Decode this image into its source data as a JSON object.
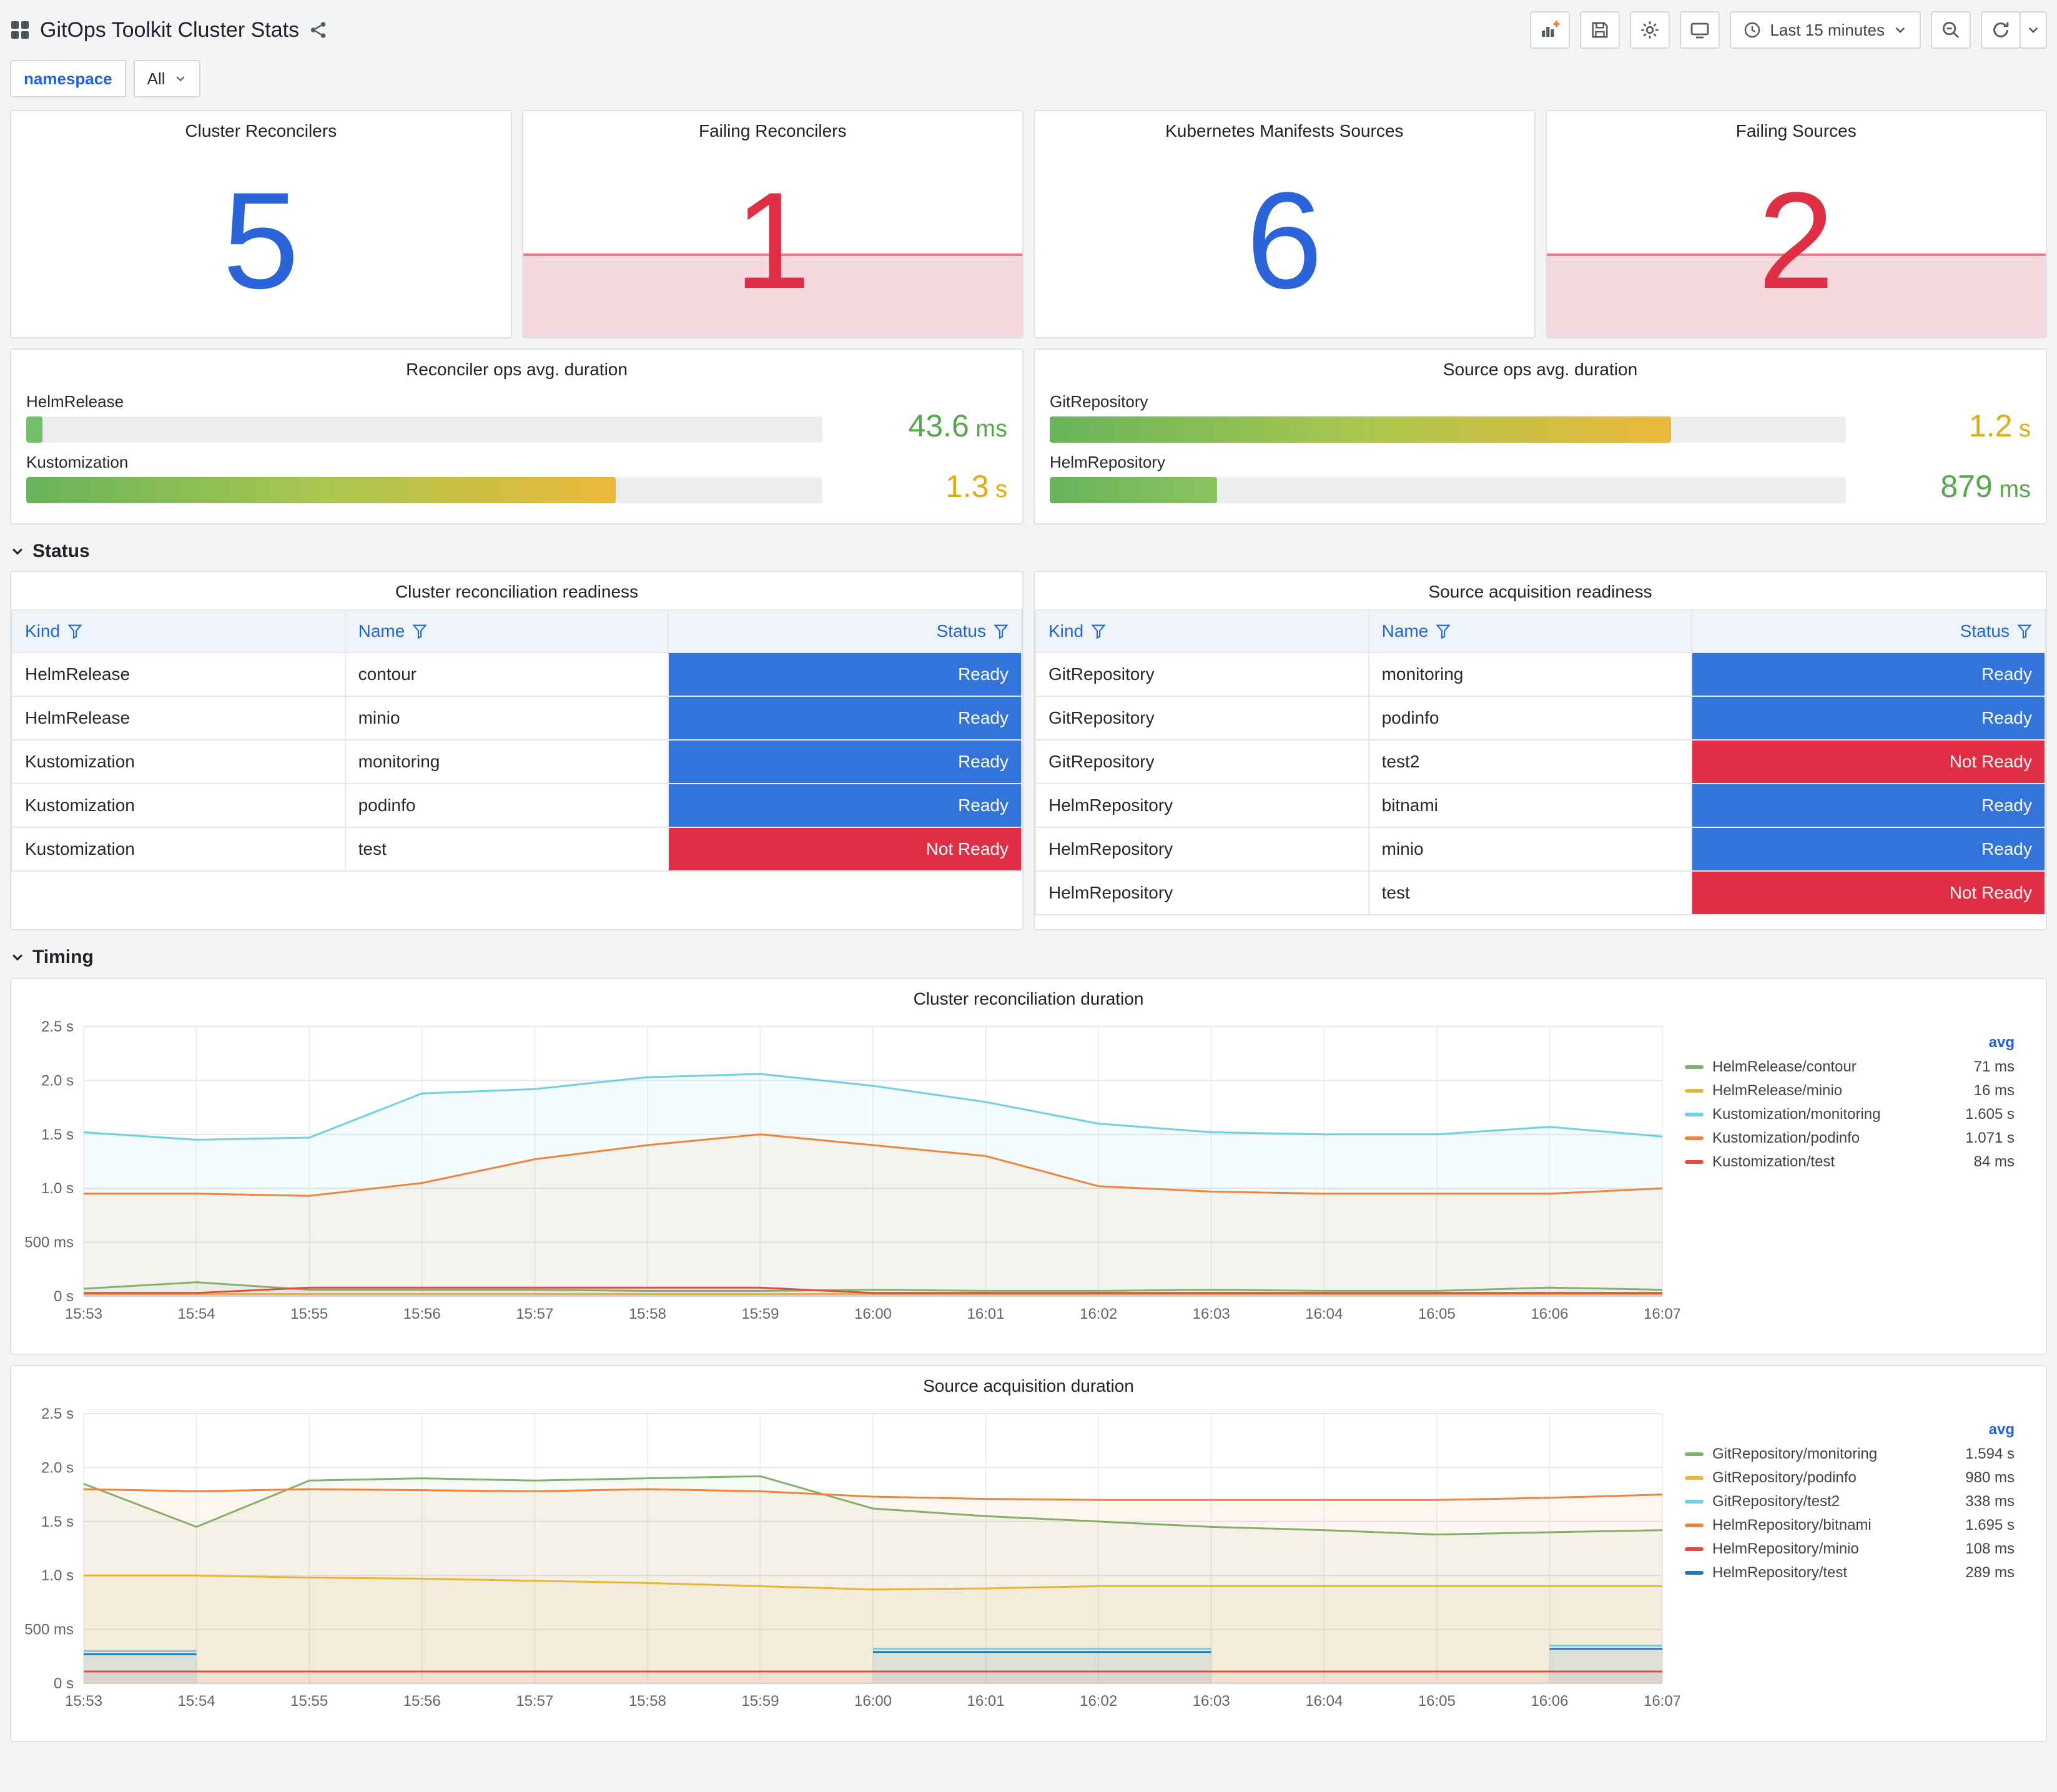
{
  "header": {
    "title": "GitOps Toolkit Cluster Stats"
  },
  "toolbar": {
    "time_range": "Last 15 minutes"
  },
  "variables": {
    "label": "namespace",
    "value": "All"
  },
  "stats": [
    {
      "title": "Cluster Reconcilers",
      "value": "5",
      "color": "#2B63D9",
      "failing": false
    },
    {
      "title": "Failing Reconcilers",
      "value": "1",
      "color": "#DE2F44",
      "failing": true
    },
    {
      "title": "Kubernetes Manifests Sources",
      "value": "6",
      "color": "#2B63D9",
      "failing": false
    },
    {
      "title": "Failing Sources",
      "value": "2",
      "color": "#DE2F44",
      "failing": true
    }
  ],
  "gauges": [
    {
      "title": "Reconciler ops avg. duration",
      "rows": [
        {
          "label": "HelmRelease",
          "pct": 2,
          "gradient": [
            "#73BF69",
            "#73BF69"
          ],
          "value": "43.6",
          "unit": "ms",
          "value_color": "#56A64B"
        },
        {
          "label": "Kustomization",
          "pct": 74,
          "gradient": [
            "#68B35B",
            "#A9C74F",
            "#EAB839"
          ],
          "value": "1.3",
          "unit": "s",
          "value_color": "#DFAB0E"
        }
      ]
    },
    {
      "title": "Source ops avg. duration",
      "rows": [
        {
          "label": "GitRepository",
          "pct": 78,
          "gradient": [
            "#68B35B",
            "#A9C74F",
            "#EAB839"
          ],
          "value": "1.2",
          "unit": "s",
          "value_color": "#DFAB0E"
        },
        {
          "label": "HelmRepository",
          "pct": 21,
          "gradient": [
            "#68B35B",
            "#8CC45F"
          ],
          "value": "879",
          "unit": "ms",
          "value_color": "#56A64B"
        }
      ]
    }
  ],
  "status_section": {
    "label": "Status"
  },
  "timing_section": {
    "label": "Timing"
  },
  "status_colors": {
    "Ready": "#3274D9",
    "Not Ready": "#E02F44"
  },
  "tables": [
    {
      "title": "Cluster reconciliation readiness",
      "columns": [
        "Kind",
        "Name",
        "Status"
      ],
      "rows": [
        [
          "HelmRelease",
          "contour",
          "Ready"
        ],
        [
          "HelmRelease",
          "minio",
          "Ready"
        ],
        [
          "Kustomization",
          "monitoring",
          "Ready"
        ],
        [
          "Kustomization",
          "podinfo",
          "Ready"
        ],
        [
          "Kustomization",
          "test",
          "Not Ready"
        ]
      ]
    },
    {
      "title": "Source acquisition readiness",
      "columns": [
        "Kind",
        "Name",
        "Status"
      ],
      "rows": [
        [
          "GitRepository",
          "monitoring",
          "Ready"
        ],
        [
          "GitRepository",
          "podinfo",
          "Ready"
        ],
        [
          "GitRepository",
          "test2",
          "Not Ready"
        ],
        [
          "HelmRepository",
          "bitnami",
          "Ready"
        ],
        [
          "HelmRepository",
          "minio",
          "Ready"
        ],
        [
          "HelmRepository",
          "test",
          "Not Ready"
        ]
      ]
    }
  ],
  "chart_data": [
    {
      "id": "reconciliation",
      "type": "line",
      "title": "Cluster reconciliation duration",
      "x_labels": [
        "15:53",
        "15:54",
        "15:55",
        "15:56",
        "15:57",
        "15:58",
        "15:59",
        "16:00",
        "16:01",
        "16:02",
        "16:03",
        "16:04",
        "16:05",
        "16:06",
        "16:07"
      ],
      "ylim": [
        0,
        2.5
      ],
      "yticks": [
        {
          "v": 0,
          "label": "0 s"
        },
        {
          "v": 0.5,
          "label": "500 ms"
        },
        {
          "v": 1,
          "label": "1.0 s"
        },
        {
          "v": 1.5,
          "label": "1.5 s"
        },
        {
          "v": 2,
          "label": "2.0 s"
        },
        {
          "v": 2.5,
          "label": "2.5 s"
        }
      ],
      "legend_header": "avg",
      "legend_position": "right",
      "grid": true,
      "series": [
        {
          "name": "HelmRelease/contour",
          "color": "#7EB26D",
          "avg": "71 ms",
          "values": [
            0.07,
            0.13,
            0.06,
            0.06,
            0.06,
            0.05,
            0.05,
            0.06,
            0.05,
            0.05,
            0.06,
            0.05,
            0.05,
            0.08,
            0.06
          ]
        },
        {
          "name": "HelmRelease/minio",
          "color": "#EAB839",
          "avg": "16 ms",
          "values": [
            0.02,
            0.02,
            0.02,
            0.02,
            0.02,
            0.02,
            0.02,
            0.02,
            0.02,
            0.02,
            0.02,
            0.02,
            0.02,
            0.02,
            0.02
          ]
        },
        {
          "name": "Kustomization/monitoring",
          "color": "#6ED0E0",
          "avg": "1.605 s",
          "values": [
            1.52,
            1.45,
            1.47,
            1.88,
            1.92,
            2.03,
            2.06,
            1.95,
            1.8,
            1.6,
            1.52,
            1.5,
            1.5,
            1.57,
            1.48
          ]
        },
        {
          "name": "Kustomization/podinfo",
          "color": "#EF843C",
          "avg": "1.071 s",
          "values": [
            0.95,
            0.95,
            0.93,
            1.05,
            1.27,
            1.4,
            1.5,
            1.4,
            1.3,
            1.02,
            0.97,
            0.95,
            0.95,
            0.95,
            1.0
          ]
        },
        {
          "name": "Kustomization/test",
          "color": "#E24D42",
          "avg": "84 ms",
          "values": [
            0.03,
            0.03,
            0.08,
            0.08,
            0.08,
            0.08,
            0.08,
            0.03,
            0.03,
            0.03,
            0.03,
            0.03,
            0.03,
            0.03,
            0.03
          ]
        }
      ]
    },
    {
      "id": "acquisition",
      "type": "line",
      "title": "Source acquisition duration",
      "x_labels": [
        "15:53",
        "15:54",
        "15:55",
        "15:56",
        "15:57",
        "15:58",
        "15:59",
        "16:00",
        "16:01",
        "16:02",
        "16:03",
        "16:04",
        "16:05",
        "16:06",
        "16:07"
      ],
      "ylim": [
        0,
        2.5
      ],
      "yticks": [
        {
          "v": 0,
          "label": "0 s"
        },
        {
          "v": 0.5,
          "label": "500 ms"
        },
        {
          "v": 1,
          "label": "1.0 s"
        },
        {
          "v": 1.5,
          "label": "1.5 s"
        },
        {
          "v": 2,
          "label": "2.0 s"
        },
        {
          "v": 2.5,
          "label": "2.5 s"
        }
      ],
      "legend_header": "avg",
      "legend_position": "right",
      "grid": true,
      "series": [
        {
          "name": "GitRepository/monitoring",
          "color": "#7EB26D",
          "avg": "1.594 s",
          "values": [
            1.85,
            1.45,
            1.88,
            1.9,
            1.88,
            1.9,
            1.92,
            1.62,
            1.55,
            1.5,
            1.45,
            1.42,
            1.38,
            1.4,
            1.42
          ]
        },
        {
          "name": "GitRepository/podinfo",
          "color": "#EAB839",
          "avg": "980 ms",
          "values": [
            1.0,
            1.0,
            0.98,
            0.97,
            0.95,
            0.93,
            0.9,
            0.87,
            0.88,
            0.9,
            0.9,
            0.9,
            0.9,
            0.9,
            0.9
          ]
        },
        {
          "name": "GitRepository/test2",
          "color": "#6ED0E0",
          "avg": "338 ms",
          "values": [
            0.3,
            0.3,
            null,
            null,
            null,
            null,
            null,
            0.32,
            0.32,
            0.32,
            0.32,
            null,
            null,
            0.35,
            0.35
          ]
        },
        {
          "name": "HelmRepository/bitnami",
          "color": "#EF843C",
          "avg": "1.695 s",
          "values": [
            1.8,
            1.78,
            1.8,
            1.79,
            1.78,
            1.8,
            1.78,
            1.73,
            1.71,
            1.7,
            1.7,
            1.7,
            1.7,
            1.72,
            1.75
          ]
        },
        {
          "name": "HelmRepository/minio",
          "color": "#E24D42",
          "avg": "108 ms",
          "values": [
            0.11,
            0.11,
            0.11,
            0.11,
            0.11,
            0.11,
            0.11,
            0.11,
            0.11,
            0.11,
            0.11,
            0.11,
            0.11,
            0.11,
            0.11
          ]
        },
        {
          "name": "HelmRepository/test",
          "color": "#1F78C1",
          "avg": "289 ms",
          "values": [
            0.27,
            0.27,
            null,
            null,
            null,
            null,
            null,
            0.29,
            0.29,
            0.29,
            0.29,
            null,
            null,
            0.32,
            0.32
          ]
        }
      ]
    }
  ]
}
